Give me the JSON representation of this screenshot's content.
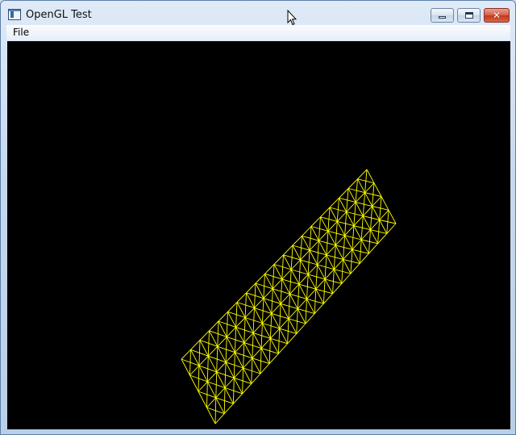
{
  "window": {
    "title": "OpenGL Test",
    "controls": {
      "minimize_icon": "minimize-icon",
      "maximize_icon": "maximize-icon",
      "close_glyph": "✕"
    }
  },
  "menubar": {
    "items": [
      {
        "label": "File"
      }
    ]
  },
  "viewport": {
    "background": "#000000",
    "mesh_color": "#ffff00"
  }
}
